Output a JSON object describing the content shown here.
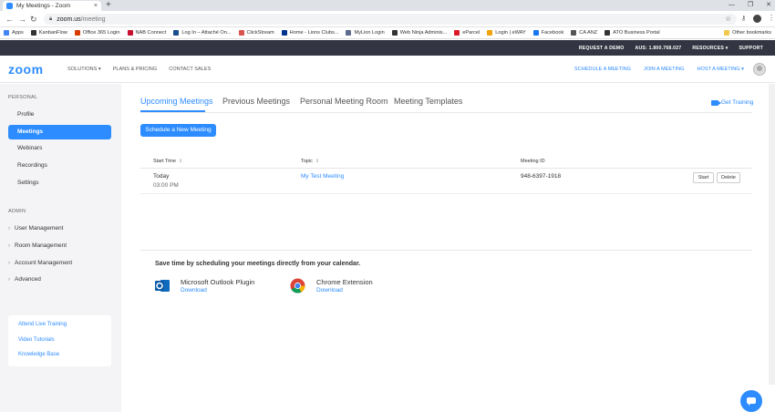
{
  "browser": {
    "tab_title": "My Meetings - Zoom",
    "tab_close": "×",
    "new_tab": "+",
    "url_domain": "zoom.us",
    "url_path": "/meeting",
    "bookmarks": [
      {
        "label": "Apps",
        "color": "#4285f4"
      },
      {
        "label": "KanbanFlow",
        "color": "#333333"
      },
      {
        "label": "Office 365 Login",
        "color": "#d83b01"
      },
      {
        "label": "NAB Connect",
        "color": "#c8102e"
      },
      {
        "label": "Log In – Attaché On...",
        "color": "#1a4f8b"
      },
      {
        "label": "ClickStream",
        "color": "#d9534f"
      },
      {
        "label": "Home - Lions Clubs...",
        "color": "#00338d"
      },
      {
        "label": "MyLion Login",
        "color": "#5b6b8c"
      },
      {
        "label": "Web Ninja Adminis...",
        "color": "#333333"
      },
      {
        "label": "eParcel",
        "color": "#dc1928"
      },
      {
        "label": "Login | eWAY",
        "color": "#f0a30a"
      },
      {
        "label": "Facebook",
        "color": "#1877f2"
      },
      {
        "label": "CA ANZ",
        "color": "#555555"
      },
      {
        "label": "ATO Business Portal",
        "color": "#333333"
      }
    ],
    "other_bookmarks": "Other bookmarks"
  },
  "topbar": {
    "request_demo": "REQUEST A DEMO",
    "phone": "AUS: 1.800.768.027",
    "resources": "RESOURCES ▾",
    "support": "SUPPORT"
  },
  "header": {
    "logo": "zoom",
    "nav": {
      "solutions": "SOLUTIONS ▾",
      "plans": "PLANS & PRICING",
      "contact": "CONTACT SALES"
    },
    "right": {
      "schedule": "SCHEDULE A MEETING",
      "join": "JOIN A MEETING",
      "host": "HOST A MEETING ▾"
    }
  },
  "sidebar": {
    "personal_head": "PERSONAL",
    "items": [
      "Profile",
      "Meetings",
      "Webinars",
      "Recordings",
      "Settings"
    ],
    "admin_head": "ADMIN",
    "admin_items": [
      "User Management",
      "Room Management",
      "Account Management",
      "Advanced"
    ],
    "help_links": [
      "Attend Live Training",
      "Video Tutorials",
      "Knowledge Base"
    ]
  },
  "content": {
    "tabs": [
      "Upcoming Meetings",
      "Previous Meetings",
      "Personal Meeting Room",
      "Meeting Templates"
    ],
    "get_training": "Get Training",
    "schedule_button": "Schedule a New Meeting",
    "columns": {
      "start_time": "Start Time",
      "topic": "Topic",
      "meeting_id": "Meeting ID"
    },
    "meeting": {
      "day": "Today",
      "time": "03:00 PM",
      "topic": "My Test Meeting",
      "id": "948-6397-1918",
      "start": "Start",
      "delete": "Delete"
    },
    "calendar": {
      "title": "Save time by scheduling your meetings directly from your calendar.",
      "outlook_name": "Microsoft Outlook Plugin",
      "outlook_download": "Download",
      "chrome_name": "Chrome Extension",
      "chrome_download": "Download"
    }
  }
}
